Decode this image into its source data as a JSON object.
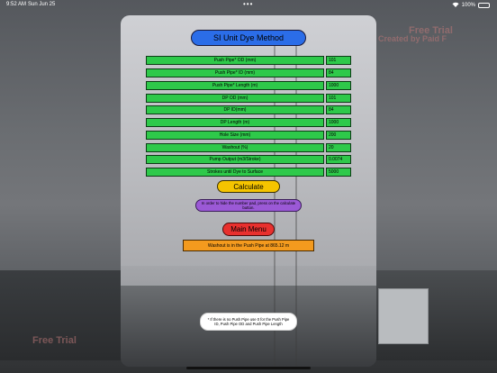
{
  "status_bar": {
    "time": "9:52 AM",
    "date": "Sun Jun 25",
    "dots": "•••",
    "battery": "100%"
  },
  "watermarks": {
    "top_right": "Free Trial",
    "top_right_sub": "Created by Paid F",
    "bottom_left": "Free Trial"
  },
  "screen": {
    "title": "SI Unit Dye Method",
    "fields": [
      {
        "label": "Push Pipe* OD (mm)",
        "value": "101"
      },
      {
        "label": "Push Pipe* ID (mm)",
        "value": "84"
      },
      {
        "label": "Push Pipe* Length (m)",
        "value": "1000"
      },
      {
        "label": "DP OD (mm)",
        "value": "101"
      },
      {
        "label": "DP ID(mm)",
        "value": "84"
      },
      {
        "label": "DP Length (m)",
        "value": "1000"
      },
      {
        "label": "Hole Size (mm)",
        "value": "200"
      },
      {
        "label": "Washout (%)",
        "value": "20"
      },
      {
        "label": "Pump Output (m3/Stroke)",
        "value": "0.0074"
      },
      {
        "label": "Strokes until Dye to Surface",
        "value": "5000"
      }
    ],
    "calculate_label": "Calculate",
    "hint": "In order to hide the number pad, press on the calculate button.",
    "main_menu_label": "Main Menu",
    "result": "Washout is in the Push Pipe at 865.12 m",
    "note": "* If there is no Push Pipe use 0 for the Push Pipe ID, Push Pipe OD and Push Pipe Length"
  },
  "colors": {
    "title_button": "#2b6de8",
    "field_green": "#2ec94a",
    "calculate_yellow": "#f5c400",
    "hint_purple": "#9b59d6",
    "menu_red": "#e8302e",
    "result_orange": "#f39a1e"
  },
  "icons": [
    "wifi-icon",
    "battery-icon"
  ]
}
